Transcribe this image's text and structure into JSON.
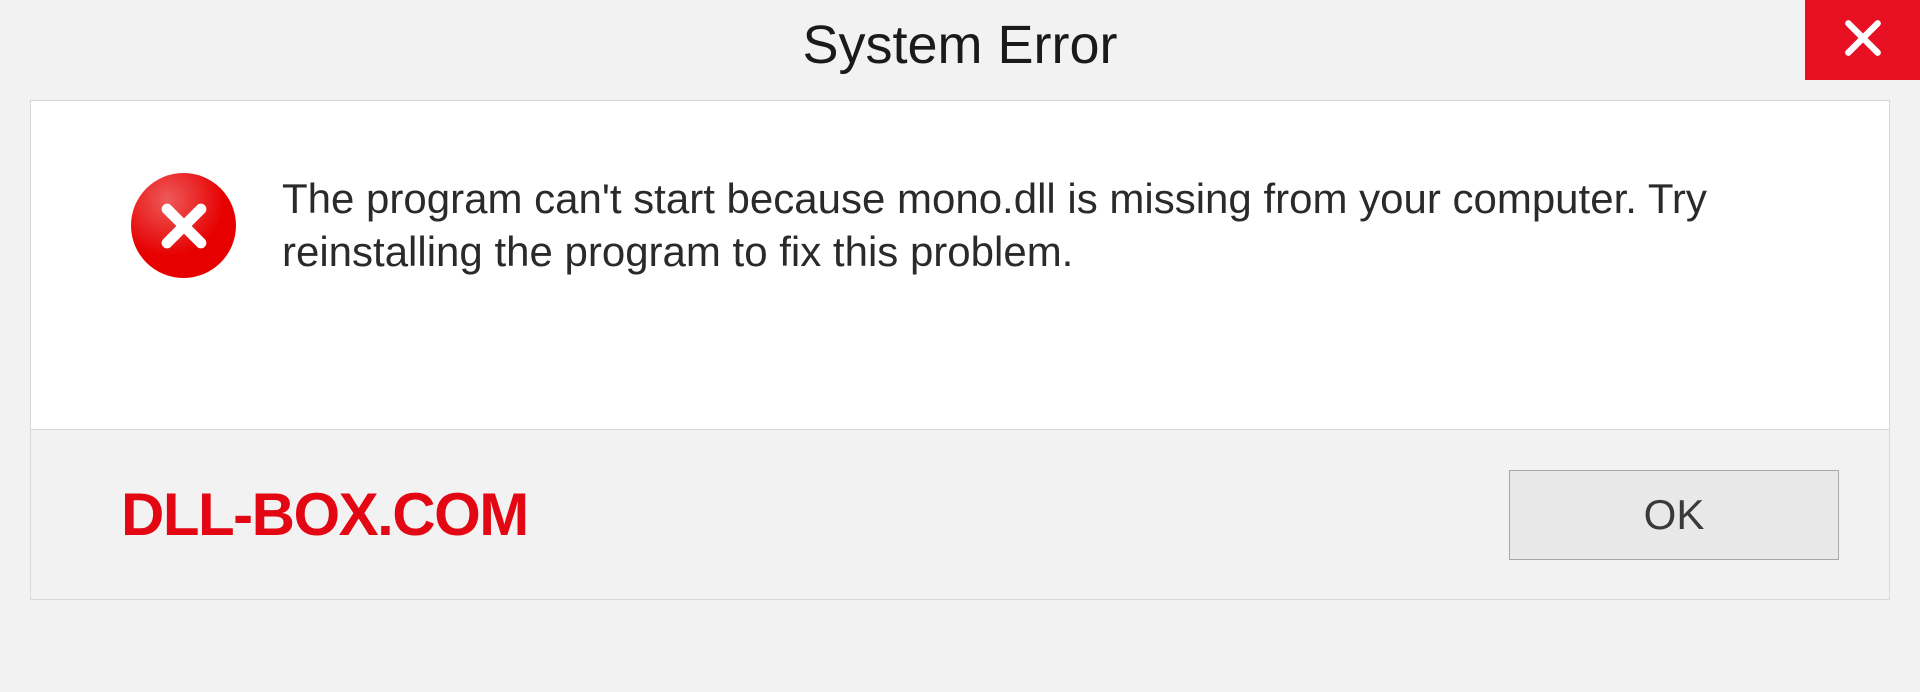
{
  "title": "System Error",
  "message": "The program can't start because mono.dll is missing from your computer. Try reinstalling the program to fix this problem.",
  "ok_label": "OK",
  "watermark": "DLL-BOX.COM"
}
